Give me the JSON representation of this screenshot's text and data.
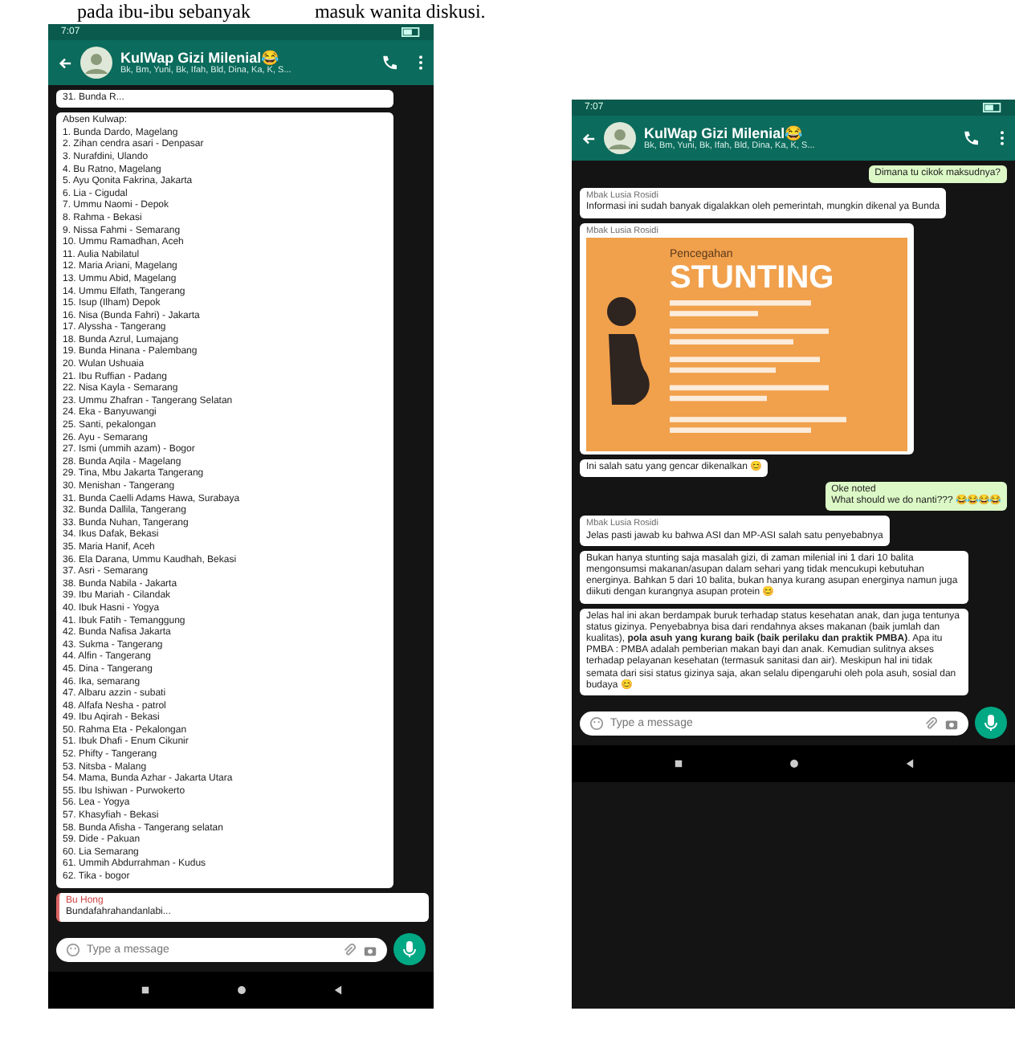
{
  "caption": [
    "pada ibu-ibu sebanyak",
    "masuk wanita diskusi."
  ],
  "phones": [
    {
      "time": "7:07",
      "title": "KulWap Gizi Milenial😂",
      "subtitle": "Bk, Bm, Yuni, Bk, Ifah, Bld, Dina, Ka, K, S...",
      "placeholder": "Type a message",
      "messages": [
        {
          "kind": "in",
          "lines": [
            "31. Bunda R..."
          ]
        },
        {
          "kind": "list",
          "lines": [
            "Absen Kulwap:",
            "1. Bunda Dardo, Magelang",
            "2. Zihan cendra asari - Denpasar",
            "3. Nurafdini, Ulando",
            "4. Bu Ratno, Magelang",
            "5. Ayu Qonita Fakrina, Jakarta",
            "6. Lia - Cigudal",
            "7. Ummu Naomi - Depok",
            "8. Rahma - Bekasi",
            "9. Nissa Fahmi - Semarang",
            "10. Ummu Ramadhan, Aceh",
            "11. Aulia Nabilatul",
            "12. Maria Ariani, Magelang",
            "13. Ummu Abid, Magelang",
            "14. Ummu Elfath, Tangerang",
            "15. Isup (Ilham) Depok",
            "16. Nisa (Bunda Fahri) - Jakarta",
            "17. Alyssha - Tangerang",
            "18. Bunda Azrul, Lumajang",
            "19. Bunda Hinana - Palembang",
            "20. Wulan Ushuaia",
            "21. Ibu Ruffian - Padang",
            "22. Nisa Kayla - Semarang",
            "23. Ummu Zhafran - Tangerang Selatan",
            "24. Eka - Banyuwangi",
            "25. Santi, pekalongan",
            "26. Ayu - Semarang",
            "27. Ismi (ummih azam) - Bogor",
            "28. Bunda Aqila - Magelang",
            "29. Tina, Mbu Jakarta Tangerang",
            "30. Menishan - Tangerang",
            "31. Bunda Caelli Adams Hawa, Surabaya",
            "32. Bunda Dallila, Tangerang",
            "33. Bunda Nuhan, Tangerang",
            "34. Ikus Dafak, Bekasi",
            "35. Maria Hanif, Aceh",
            "36. Ela Darana, Ummu Kaudhah, Bekasi",
            "37. Asri - Semarang",
            "38. Bunda Nabila - Jakarta",
            "39. Ibu Mariah - Cilandak",
            "40. Ibuk Hasni - Yogya",
            "41. Ibuk Fatih - Temanggung",
            "42. Bunda Nafisa Jakarta",
            "43. Sukma - Tangerang",
            "44. Alfin - Tangerang",
            "45. Dina - Tangerang",
            "46. Ika, semarang",
            "47. Albaru azzin - subati",
            "48. Alfafa Nesha - patrol",
            "49. Ibu Aqirah - Bekasi",
            "50. Rahma Eta - Pekalongan",
            "51. Ibuk Dhafi - Enum Cikunir",
            "52. Phifty - Tangerang",
            "53. Nitsba - Malang",
            "54. Mama, Bunda Azhar - Jakarta Utara",
            "55. Ibu Ishiwan - Purwokerto",
            "56. Lea - Yogya",
            "57. Khasyfiah - Bekasi",
            "58. Bunda Afisha - Tangerang selatan",
            "59. Dide - Pakuan",
            "60. Lia Semarang",
            "61. Ummih Abdurrahman - Kudus",
            "62. Tika - bogor"
          ]
        },
        {
          "kind": "reply",
          "name": "Bu Hong",
          "lines": [
            "Bundafahrahandanlabi..."
          ]
        }
      ]
    },
    {
      "time": "7:07",
      "title": "KulWap Gizi Milenial😂",
      "subtitle": "Bk, Bm, Yuni, Bk, Ifah, Bld, Dina, Ka, K, S...",
      "placeholder": "Type a message",
      "messages": [
        {
          "kind": "out",
          "lines": [
            "Dimana tu cikok maksudnya?"
          ]
        },
        {
          "kind": "in",
          "sender": "Mbak Lusia Rosidi",
          "lines": [
            "Informasi ini sudah banyak digalakkan oleh pemerintah, mungkin dikenal ya Bunda"
          ]
        },
        {
          "kind": "image",
          "sender": "Mbak Lusia Rosidi",
          "overline": "Pencegahan",
          "headline": "STUNTING"
        },
        {
          "kind": "in",
          "lines": [
            "Ini salah satu yang gencar dikenalkan 😊"
          ]
        },
        {
          "kind": "out",
          "lines": [
            "Oke noted",
            "What should we do nanti??? 😂😂😂😂"
          ]
        },
        {
          "kind": "in",
          "sender": "Mbak Lusia Rosidi",
          "lines": [
            "Jelas pasti jawab ku bahwa ASI dan MP-ASI salah satu penyebabnya"
          ]
        },
        {
          "kind": "in",
          "lines": [
            "Bukan hanya stunting saja masalah gizi, di zaman milenial ini 1 dari 10 balita mengonsumsi makanan/asupan dalam sehari yang tidak mencukupi kebutuhan energinya. Bahkan 5 dari 10 balita, bukan hanya kurang asupan energinya namun juga diikuti dengan kurangnya asupan protein 😊"
          ]
        },
        {
          "kind": "in",
          "lines": [
            "Jelas hal ini akan berdampak buruk terhadap status kesehatan anak, dan juga tentunya status gizinya. Penyebabnya bisa dari rendahnya akses makanan (baik jumlah dan kualitas), **pola asuh yang kurang baik (baik perilaku dan praktik PMBA)**. Apa itu PMBA : PMBA adalah pemberian makan bayi dan anak. Kemudian sulitnya akses terhadap pelayanan kesehatan (termasuk sanitasi dan air). Meskipun hal ini tidak semata dari sisi status gizinya saja, akan selalu dipengaruhi oleh pola asuh, sosial dan budaya 😊"
          ]
        }
      ]
    }
  ]
}
